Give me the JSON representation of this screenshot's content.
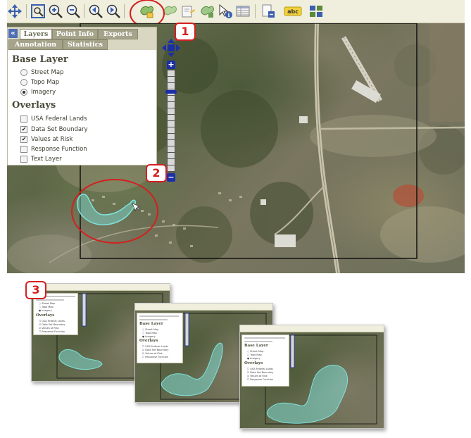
{
  "toolbar": {
    "tools": [
      {
        "icon": "pan-icon"
      },
      {
        "icon": "zoom-extent-icon"
      },
      {
        "icon": "zoom-in-icon"
      },
      {
        "icon": "zoom-out-icon"
      },
      {
        "icon": "zoom-previous-icon"
      },
      {
        "icon": "zoom-next-icon"
      },
      {
        "icon": "select-polygon-icon"
      },
      {
        "icon": "draw-polygon-icon"
      },
      {
        "icon": "edit-polygon-icon"
      },
      {
        "icon": "polygon-tool-icon"
      },
      {
        "icon": "identify-icon"
      },
      {
        "icon": "table-icon"
      },
      {
        "icon": "export-icon"
      },
      {
        "icon": "label-icon",
        "label": "abc"
      },
      {
        "icon": "layers-grid-icon"
      }
    ]
  },
  "panel": {
    "tabs": {
      "layers": "Layers",
      "point_info": "Point Info",
      "exports": "Exports",
      "annotation": "Annotation",
      "statistics": "Statistics"
    },
    "base_layer": {
      "title": "Base Layer",
      "options": [
        "Street Map",
        "Topo Map",
        "Imagery"
      ],
      "selected": "Imagery"
    },
    "overlays": {
      "title": "Overlays",
      "items": [
        {
          "label": "USA Federal Lands",
          "checked": false
        },
        {
          "label": "Data Set Boundary",
          "checked": true
        },
        {
          "label": "Values at Risk",
          "checked": true
        },
        {
          "label": "Response Function",
          "checked": false
        },
        {
          "label": "Text Layer",
          "checked": false
        }
      ]
    }
  },
  "callouts": {
    "one": "1",
    "two": "2",
    "three": "3"
  },
  "colors": {
    "callout_red": "#d41f1f",
    "polygon_fill": "#7fe3dc",
    "zoom_blue": "#1a2fa8",
    "toolbar_bg": "#f0eedc"
  }
}
